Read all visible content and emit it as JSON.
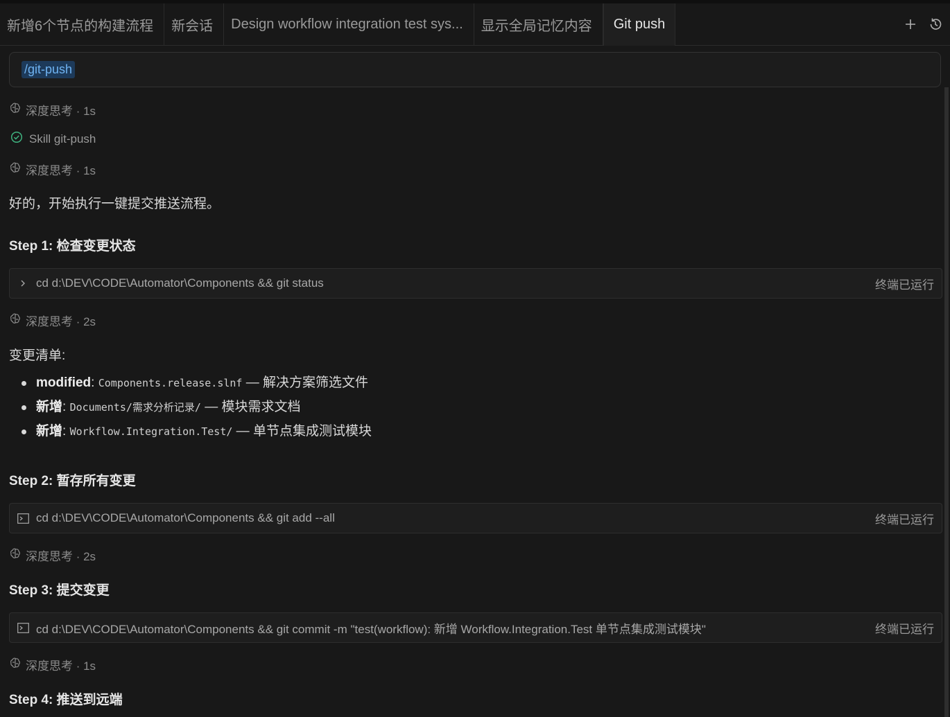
{
  "tabs": [
    {
      "label": "新增6个节点的构建流程",
      "active": false
    },
    {
      "label": "新会话",
      "active": false
    },
    {
      "label": "Design workflow integration test sys...",
      "active": false
    },
    {
      "label": "显示全局记忆内容",
      "active": false
    },
    {
      "label": "Git push",
      "active": true
    }
  ],
  "tab_actions": {
    "new_icon": "plus-icon",
    "history_icon": "history-icon"
  },
  "prompt": {
    "chip": "/git-push"
  },
  "thinking": [
    {
      "label": "深度思考 · 1s"
    },
    {
      "label": "深度思考 · 1s"
    },
    {
      "label": "深度思考 · 2s"
    },
    {
      "label": "深度思考 · 2s"
    },
    {
      "label": "深度思考 · 1s"
    }
  ],
  "skill": {
    "label": "Skill git-push",
    "status_icon": "check-circle-icon"
  },
  "intro": "好的，开始执行一键提交推送流程。",
  "steps": [
    {
      "title": "Step 1: 检查变更状态"
    },
    {
      "title": "Step 2: 暂存所有变更"
    },
    {
      "title": "Step 3: 提交变更"
    },
    {
      "title": "Step 4: 推送到远端"
    }
  ],
  "commands": [
    {
      "icon": "chevron-right-icon",
      "text": "cd d:\\DEV\\CODE\\Automator\\Components && git status",
      "status": "终端已运行"
    },
    {
      "icon": "terminal-icon",
      "text": "cd d:\\DEV\\CODE\\Automator\\Components && git add --all",
      "status": "终端已运行"
    },
    {
      "icon": "terminal-icon",
      "text": "cd d:\\DEV\\CODE\\Automator\\Components && git commit -m \"test(workflow): 新增 Workflow.Integration.Test 单节点集成测试模块\"",
      "status": "终端已运行"
    }
  ],
  "changes_title": "变更清单:",
  "changes": [
    {
      "kind": "modified",
      "sep": ": ",
      "path": "Components.release.slnf",
      "desc": " — 解决方案筛选文件"
    },
    {
      "kind": "新增",
      "sep": ": ",
      "path": "Documents/需求分析记录/",
      "desc": " — 模块需求文档"
    },
    {
      "kind": "新增",
      "sep": ": ",
      "path": "Workflow.Integration.Test/",
      "desc": " — 单节点集成测试模块"
    }
  ]
}
